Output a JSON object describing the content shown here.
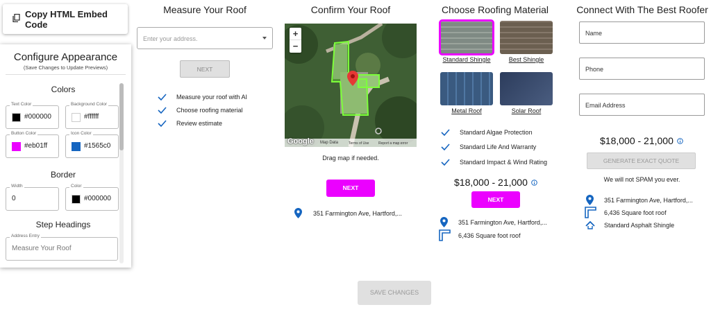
{
  "copy_button": {
    "label": "Copy HTML Embed Code",
    "icon": "copy-icon"
  },
  "config": {
    "title": "Configure Appearance",
    "subtitle": "(Save Changes to Update Previews)",
    "colors_heading": "Colors",
    "text_color": {
      "label": "Text Color",
      "value": "#000000"
    },
    "background_color": {
      "label": "Background Color",
      "value": "#ffffff"
    },
    "button_color": {
      "label": "Button Color",
      "value": "#eb01ff"
    },
    "icon_color": {
      "label": "Icon Color",
      "value": "#1565c0"
    },
    "border_heading": "Border",
    "border_width": {
      "label": "Width",
      "value": "0"
    },
    "border_color": {
      "label": "Color",
      "value": "#000000"
    },
    "step_headings": "Step Headings",
    "address_entry": {
      "label": "Address Entry",
      "value": "Measure Your Roof"
    }
  },
  "measure": {
    "title": "Measure Your Roof",
    "placeholder": "Enter your address.",
    "next_label": "NEXT",
    "checks": [
      "Measure your roof with AI",
      "Choose roofing material",
      "Review estimate"
    ]
  },
  "confirm": {
    "title": "Confirm Your Roof",
    "zoom_in": "+",
    "zoom_out": "−",
    "map_brand": "Google",
    "map_data": "Map Data",
    "terms": "Terms of Use",
    "report": "Report a map error",
    "drag_hint": "Drag map if needed.",
    "next_label": "NEXT",
    "address": "351 Farmington Ave, Hartford,..."
  },
  "material": {
    "title": "Choose Roofing Material",
    "options": [
      {
        "label": "Standard Shingle",
        "selected": true
      },
      {
        "label": "Best Shingle"
      },
      {
        "label": "Metal Roof"
      },
      {
        "label": "Solar Roof"
      }
    ],
    "features": [
      "Standard Algae Protection",
      "Standard Life And Warranty",
      "Standard Impact & Wind Rating"
    ],
    "price": "$18,000 - 21,000",
    "next_label": "NEXT",
    "address": "351 Farmington Ave, Hartford,...",
    "area": "6,436 Square foot roof"
  },
  "connect": {
    "title": "Connect With The Best Roofer",
    "name": "Name",
    "phone": "Phone",
    "email": "Email Address",
    "price": "$18,000 - 21,000",
    "quote_label": "GENERATE EXACT QUOTE",
    "spam": "We will not SPAM you ever.",
    "address": "351 Farmington Ave, Hartford,...",
    "area": "6,436 Square foot roof",
    "roof_type": "Standard Asphalt Shingle"
  },
  "save_label": "SAVE CHANGES",
  "colors": {
    "accent": "#eb01ff",
    "icon": "#1565c0"
  }
}
